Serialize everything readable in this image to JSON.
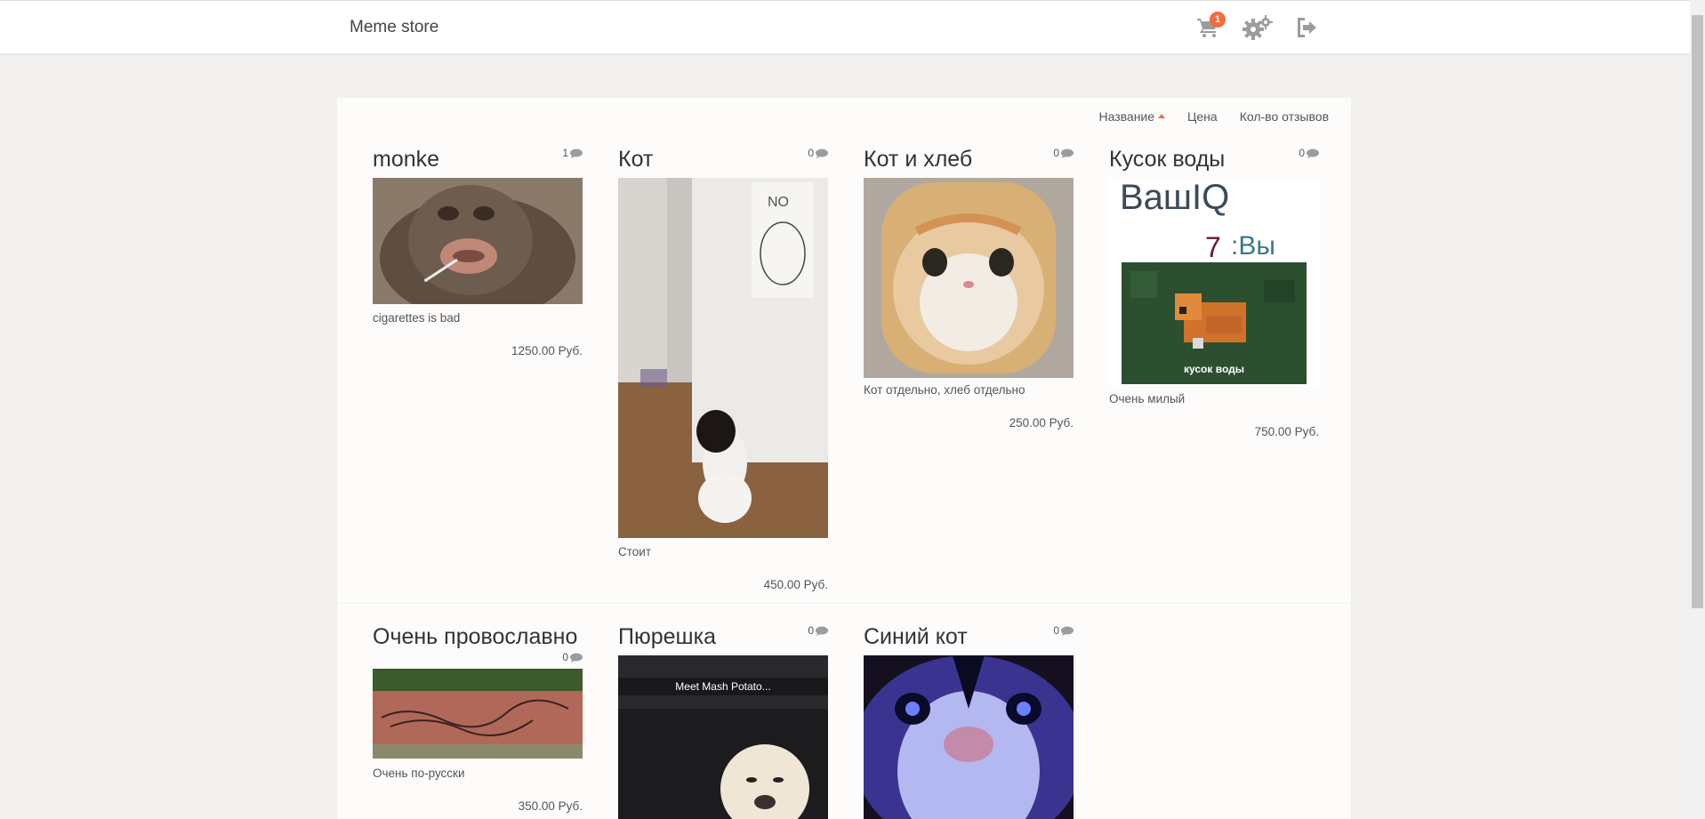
{
  "header": {
    "brand": "Meme store",
    "cart_count": "1",
    "icons": [
      "cart-icon",
      "gears-icon",
      "logout-icon"
    ]
  },
  "sort": {
    "name_label": "Название",
    "price_label": "Цена",
    "reviews_label": "Кол-во отзывов"
  },
  "products": [
    {
      "title": "monke",
      "reviews": "1",
      "description": "cigarettes is bad",
      "price": "1250.00 Руб."
    },
    {
      "title": "Кот",
      "reviews": "0",
      "description": "Стоит",
      "price": "450.00 Руб."
    },
    {
      "title": "Кот и хлеб",
      "reviews": "0",
      "description": "Кот отдельно, хлеб отдельно",
      "price": "250.00 Руб."
    },
    {
      "title": "Кусок воды",
      "reviews": "0",
      "description": "Очень милый",
      "price": "750.00 Руб.",
      "image_text": {
        "top": "ВашIQ",
        "iq": "7",
        "you": ":Вы",
        "caption": "кусок воды"
      }
    },
    {
      "title": "Очень провославно",
      "reviews": "0",
      "description": "Очень по-русски",
      "price": "350.00 Руб."
    },
    {
      "title": "Пюрешка",
      "reviews": "0",
      "image_text": {
        "caption": "Meet Mash Potato..."
      }
    },
    {
      "title": "Синий кот",
      "reviews": "0"
    }
  ],
  "colors": {
    "accent": "#f36c3e",
    "icon": "#9c9c9c",
    "background": "#f2f0ee"
  }
}
